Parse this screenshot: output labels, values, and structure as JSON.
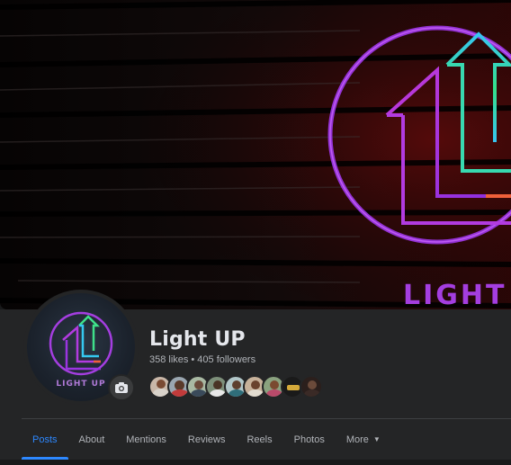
{
  "page": {
    "name": "Light UP",
    "likes": "358 likes",
    "followers": "405 followers",
    "separator": "•"
  },
  "cover": {
    "logo_text": "LIGHT U"
  },
  "avatar": {
    "logo_text": "LIGHT UP"
  },
  "icons": {
    "camera": "camera-icon",
    "caret": "caret-down-icon"
  },
  "tabs": [
    {
      "label": "Posts",
      "active": true
    },
    {
      "label": "About"
    },
    {
      "label": "Mentions"
    },
    {
      "label": "Reviews"
    },
    {
      "label": "Reels"
    },
    {
      "label": "Photos"
    },
    {
      "label": "More"
    }
  ],
  "colors": {
    "accent": "#2d88ff",
    "background": "#242526",
    "text_primary": "#e4e6eb",
    "text_secondary": "#b0b3b8",
    "neon_purple": "#a43ee0",
    "neon_green": "#3fe08a",
    "neon_cyan": "#35c9f0"
  }
}
